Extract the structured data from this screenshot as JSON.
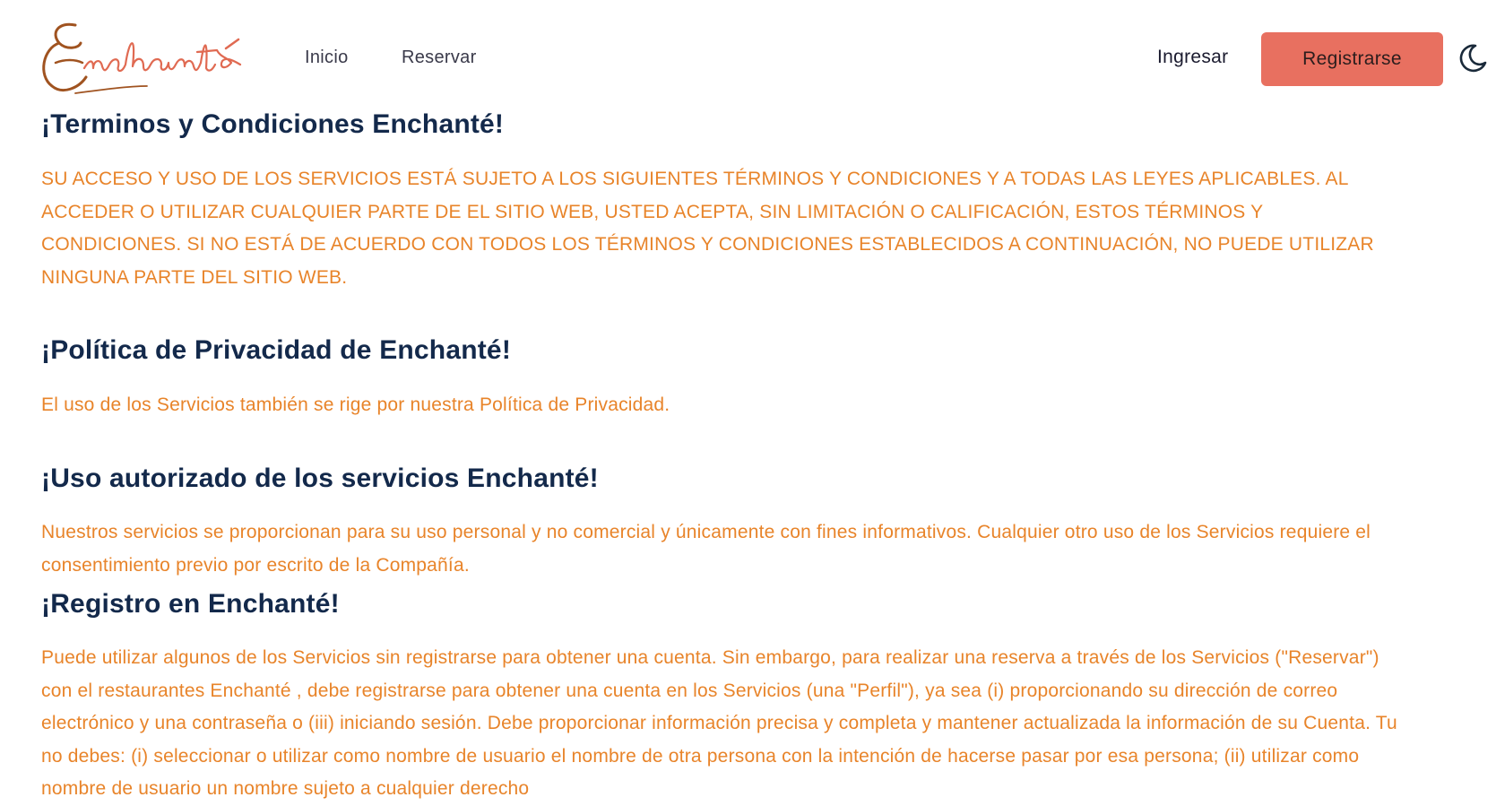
{
  "brand": {
    "logo_text": "Enchanté"
  },
  "nav": {
    "links": [
      "Inicio",
      "Reservar"
    ],
    "login_label": "Ingresar",
    "register_label": "Registrarse",
    "theme_icon": "moon-icon"
  },
  "colors": {
    "accent": "#e87060",
    "heading": "#13294b",
    "body_text": "#e8842a",
    "logo_dark": "#a05320",
    "logo_light": "#e06a52"
  },
  "sections": [
    {
      "title": "¡Terminos y Condiciones Enchanté!",
      "text": "SU ACCESO Y USO DE LOS SERVICIOS ESTÁ SUJETO A LOS SIGUIENTES TÉRMINOS Y CONDICIONES Y A TODAS LAS LEYES APLICABLES. AL ACCEDER O UTILIZAR CUALQUIER PARTE DE EL SITIO WEB, USTED ACEPTA, SIN LIMITACIÓN O CALIFICACIÓN, ESTOS TÉRMINOS Y CONDICIONES. SI NO ESTÁ DE ACUERDO CON TODOS LOS TÉRMINOS Y CONDICIONES ESTABLECIDOS A CONTINUACIÓN, NO PUEDE UTILIZAR NINGUNA PARTE DEL SITIO WEB."
    },
    {
      "title": "¡Política de Privacidad de Enchanté!",
      "text": "El uso de los Servicios también se rige por nuestra Política de Privacidad."
    },
    {
      "title": "¡Uso autorizado de los servicios Enchanté!",
      "text": "Nuestros servicios se proporcionan para su uso personal y no comercial y únicamente con fines informativos. Cualquier otro uso de los Servicios requiere el consentimiento previo por escrito de la Compañía."
    },
    {
      "title": "¡Registro en Enchanté!",
      "text": "Puede utilizar algunos de los Servicios sin registrarse para obtener una cuenta. Sin embargo, para realizar una reserva a través de los Servicios (\"Reservar\") con el restaurantes Enchanté , debe registrarse para obtener una cuenta en los Servicios (una \"Perfil\"), ya sea (i) proporcionando su dirección de correo electrónico y una contraseña o (iii) iniciando sesión. Debe proporcionar información precisa y completa y mantener actualizada la información de su Cuenta. Tu no debes: (i) seleccionar o utilizar como nombre de usuario el nombre de otra persona con la intención de hacerse pasar por esa persona; (ii) utilizar como nombre de usuario un nombre sujeto a cualquier derecho"
    }
  ]
}
